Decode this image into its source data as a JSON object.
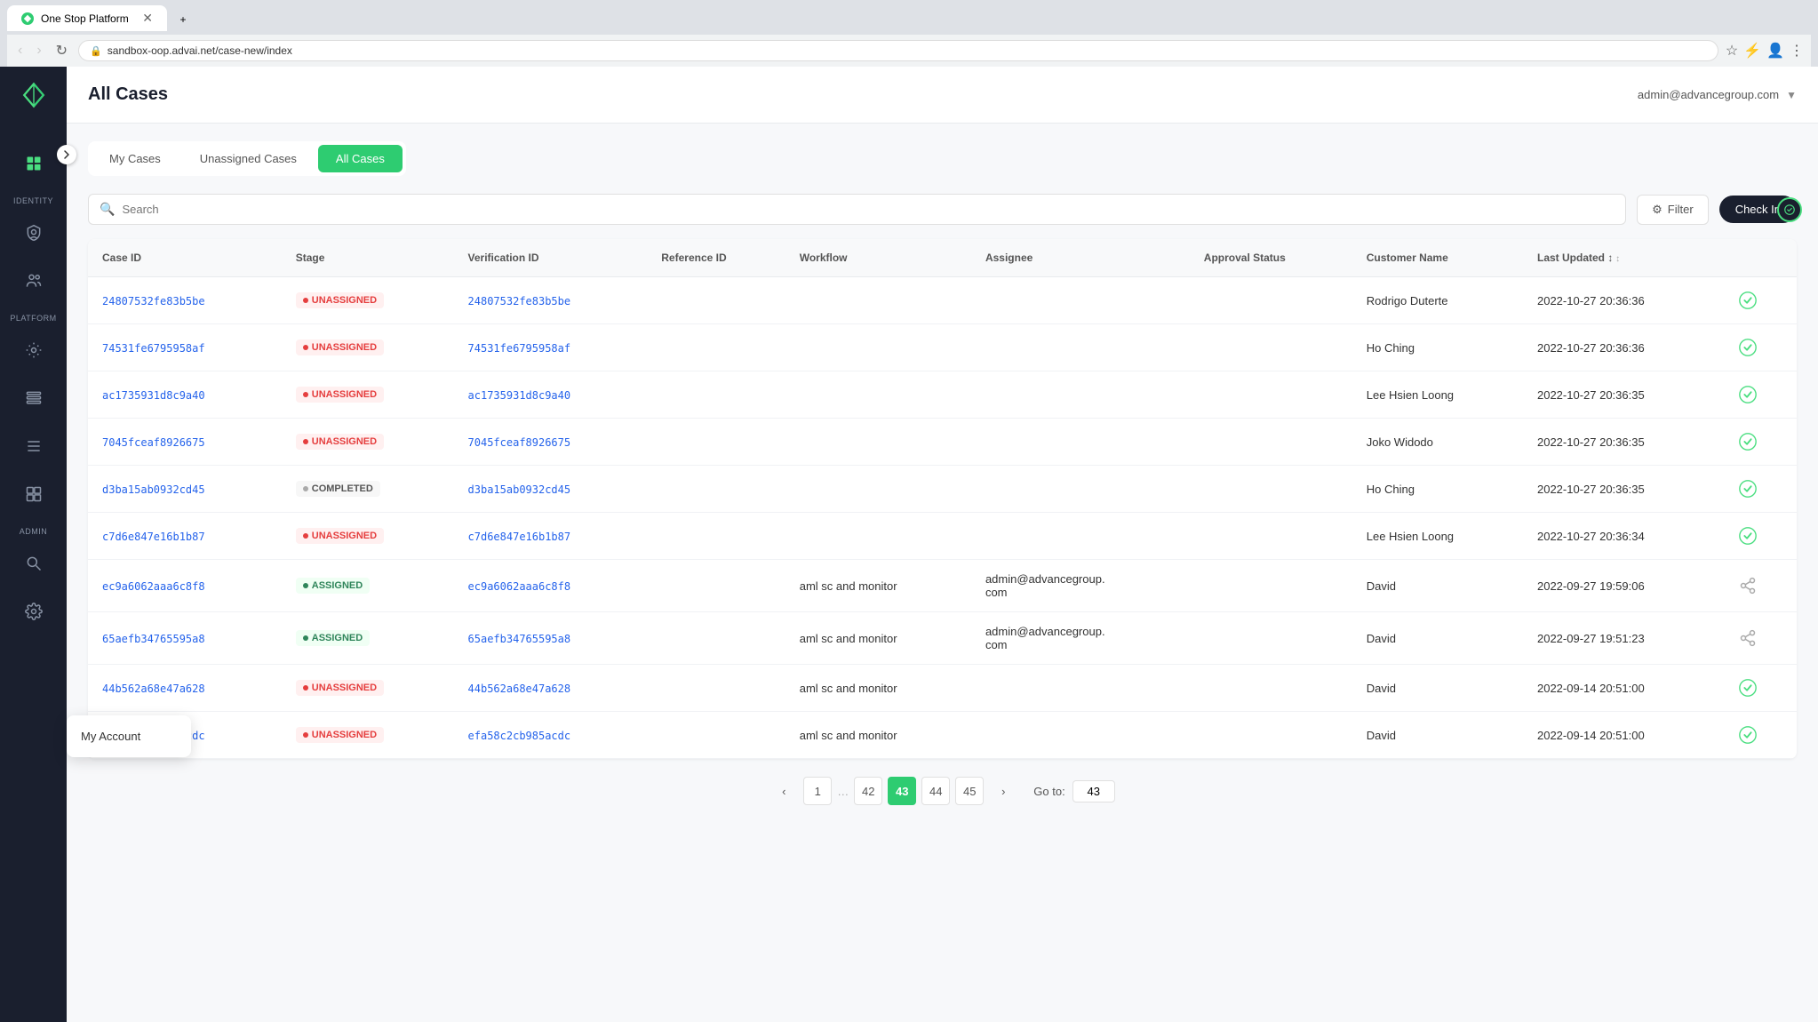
{
  "browser": {
    "tab_title": "One Stop Platform",
    "tab_favicon": "A",
    "url": "sandbox-oop.advai.net/case-new/index",
    "user_icon": "👤"
  },
  "header": {
    "title": "All Cases",
    "user_email": "admin@advancegroup.com"
  },
  "tabs": [
    {
      "id": "my-cases",
      "label": "My Cases",
      "active": false
    },
    {
      "id": "unassigned-cases",
      "label": "Unassigned Cases",
      "active": false
    },
    {
      "id": "all-cases",
      "label": "All Cases",
      "active": true
    }
  ],
  "toolbar": {
    "search_placeholder": "Search",
    "filter_label": "Filter",
    "checkin_label": "Check In"
  },
  "table": {
    "columns": [
      {
        "id": "case-id",
        "label": "Case ID",
        "sortable": false
      },
      {
        "id": "stage",
        "label": "Stage",
        "sortable": false
      },
      {
        "id": "verification-id",
        "label": "Verification ID",
        "sortable": false
      },
      {
        "id": "reference-id",
        "label": "Reference ID",
        "sortable": false
      },
      {
        "id": "workflow",
        "label": "Workflow",
        "sortable": false
      },
      {
        "id": "assignee",
        "label": "Assignee",
        "sortable": false
      },
      {
        "id": "approval-status",
        "label": "Approval Status",
        "sortable": false
      },
      {
        "id": "customer-name",
        "label": "Customer Name",
        "sortable": false
      },
      {
        "id": "last-updated",
        "label": "Last Updated",
        "sortable": true
      },
      {
        "id": "action",
        "label": "",
        "sortable": false
      }
    ],
    "rows": [
      {
        "case_id": "24807532fe83b5be",
        "stage": "UNASSIGNED",
        "stage_type": "unassigned",
        "verification_id": "24807532fe83b5be",
        "reference_id": "",
        "workflow": "",
        "assignee": "",
        "approval_status": "",
        "customer_name": "Rodrigo Duterte",
        "last_updated": "2022-10-27 20:36:36",
        "action_type": "check"
      },
      {
        "case_id": "74531fe6795958af",
        "stage": "UNASSIGNED",
        "stage_type": "unassigned",
        "verification_id": "74531fe6795958af",
        "reference_id": "",
        "workflow": "",
        "assignee": "",
        "approval_status": "",
        "customer_name": "Ho Ching",
        "last_updated": "2022-10-27 20:36:36",
        "action_type": "check"
      },
      {
        "case_id": "ac1735931d8c9a40",
        "stage": "UNASSIGNED",
        "stage_type": "unassigned",
        "verification_id": "ac1735931d8c9a40",
        "reference_id": "",
        "workflow": "",
        "assignee": "",
        "approval_status": "",
        "customer_name": "Lee Hsien Loong",
        "last_updated": "2022-10-27 20:36:35",
        "action_type": "check"
      },
      {
        "case_id": "7045fceaf8926675",
        "stage": "UNASSIGNED",
        "stage_type": "unassigned",
        "verification_id": "7045fceaf8926675",
        "reference_id": "",
        "workflow": "",
        "assignee": "",
        "approval_status": "",
        "customer_name": "Joko Widodo",
        "last_updated": "2022-10-27 20:36:35",
        "action_type": "check"
      },
      {
        "case_id": "d3ba15ab0932cd45",
        "stage": "COMPLETED",
        "stage_type": "completed",
        "verification_id": "d3ba15ab0932cd45",
        "reference_id": "",
        "workflow": "",
        "assignee": "",
        "approval_status": "",
        "customer_name": "Ho Ching",
        "last_updated": "2022-10-27 20:36:35",
        "action_type": "check"
      },
      {
        "case_id": "c7d6e847e16b1b87",
        "stage": "UNASSIGNED",
        "stage_type": "unassigned",
        "verification_id": "c7d6e847e16b1b87",
        "reference_id": "",
        "workflow": "",
        "assignee": "",
        "approval_status": "",
        "customer_name": "Lee Hsien Loong",
        "last_updated": "2022-10-27 20:36:34",
        "action_type": "check"
      },
      {
        "case_id": "ec9a6062aaa6c8f8",
        "stage": "ASSIGNED",
        "stage_type": "assigned",
        "verification_id": "ec9a6062aaa6c8f8",
        "reference_id": "",
        "workflow": "aml sc and monitor",
        "assignee": "admin@advancegroup.com",
        "approval_status": "",
        "customer_name": "David",
        "last_updated": "2022-09-27 19:59:06",
        "action_type": "share"
      },
      {
        "case_id": "65aefb34765595a8",
        "stage": "ASSIGNED",
        "stage_type": "assigned",
        "verification_id": "65aefb34765595a8",
        "reference_id": "",
        "workflow": "aml sc and monitor",
        "assignee": "admin@advancegroup.com",
        "approval_status": "",
        "customer_name": "David",
        "last_updated": "2022-09-27 19:51:23",
        "action_type": "share"
      },
      {
        "case_id": "44b562a68e47a628",
        "stage": "UNASSIGNED",
        "stage_type": "unassigned",
        "verification_id": "44b562a68e47a628",
        "reference_id": "",
        "workflow": "aml sc and monitor",
        "assignee": "",
        "approval_status": "",
        "customer_name": "David",
        "last_updated": "2022-09-14 20:51:00",
        "action_type": "check"
      },
      {
        "case_id": "efa58c2cb985acdc",
        "stage": "UNASSIGNED",
        "stage_type": "unassigned",
        "verification_id": "efa58c2cb985acdc",
        "reference_id": "",
        "workflow": "aml sc and monitor",
        "assignee": "",
        "approval_status": "",
        "customer_name": "David",
        "last_updated": "2022-09-14 20:51:00",
        "action_type": "check"
      }
    ]
  },
  "pagination": {
    "prev_label": "‹",
    "next_label": "›",
    "first_page": "1",
    "dots": "…",
    "page_42": "42",
    "page_43": "43",
    "page_44": "44",
    "page_45": "45",
    "current_page": "43",
    "goto_label": "Go to:",
    "goto_value": "43"
  },
  "sidebar": {
    "logo_text": "A",
    "toggle_icon": "›",
    "sections": {
      "identity_label": "Identity",
      "platform_label": "Platform",
      "admin_label": "Admin"
    },
    "items": [
      {
        "id": "dashboard",
        "icon": "grid",
        "label": "Dashboard",
        "section": "top"
      },
      {
        "id": "identity-shield",
        "icon": "shield",
        "label": "",
        "section": "identity"
      },
      {
        "id": "identity-users",
        "icon": "users",
        "label": "",
        "section": "identity"
      },
      {
        "id": "platform-settings",
        "icon": "gear",
        "label": "",
        "section": "platform"
      },
      {
        "id": "platform-list",
        "icon": "list",
        "label": "",
        "section": "platform"
      },
      {
        "id": "platform-menu",
        "icon": "menu",
        "label": "",
        "section": "platform"
      },
      {
        "id": "platform-widgets",
        "icon": "widgets",
        "label": "",
        "section": "platform"
      },
      {
        "id": "admin-search",
        "icon": "search",
        "label": "",
        "section": "admin"
      },
      {
        "id": "admin-config",
        "icon": "config",
        "label": "",
        "section": "admin"
      }
    ],
    "popover": {
      "visible": true,
      "items": [
        {
          "id": "my-account",
          "label": "My Account"
        }
      ]
    }
  }
}
